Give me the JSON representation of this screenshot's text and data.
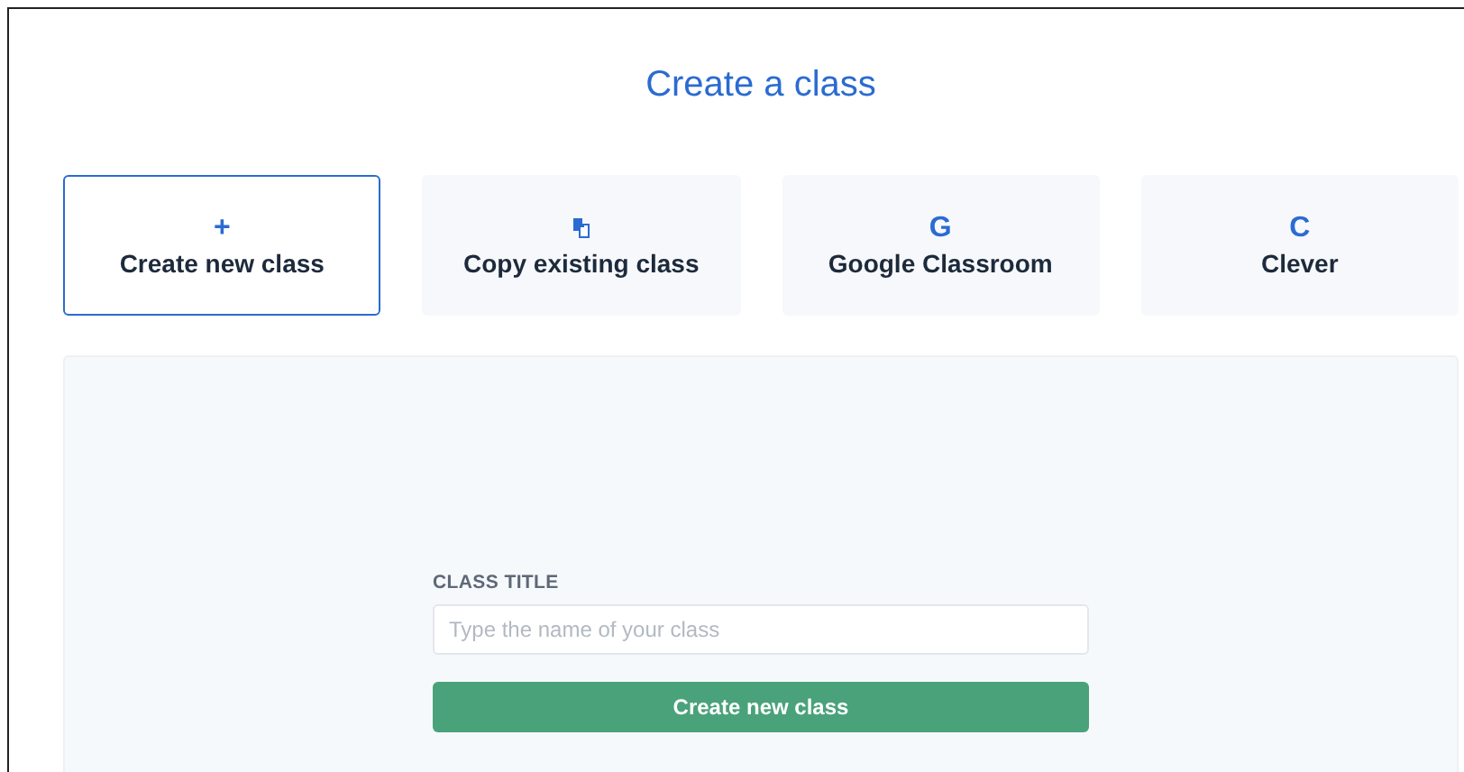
{
  "title": "Create a class",
  "options": [
    {
      "kind": "glyph",
      "icon": "+",
      "label": "Create new class",
      "selected": true
    },
    {
      "kind": "copy",
      "label": "Copy existing class",
      "selected": false
    },
    {
      "kind": "glyph",
      "icon": "G",
      "label": "Google Classroom",
      "selected": false
    },
    {
      "kind": "glyph",
      "icon": "C",
      "label": "Clever",
      "selected": false
    }
  ],
  "form": {
    "label": "CLASS TITLE",
    "placeholder": "Type the name of your class",
    "button": "Create new class"
  }
}
